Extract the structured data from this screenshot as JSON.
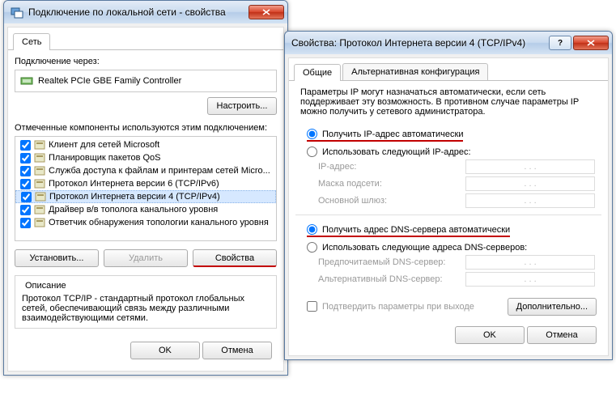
{
  "win1": {
    "title": "Подключение по локальной сети - свойства",
    "tab": "Сеть",
    "connect_via": "Подключение через:",
    "adapter": "Realtek PCIe GBE Family Controller",
    "configure": "Настроить...",
    "components_label": "Отмеченные компоненты используются этим подключением:",
    "items": [
      {
        "label": "Клиент для сетей Microsoft",
        "checked": true
      },
      {
        "label": "Планировщик пакетов QoS",
        "checked": true
      },
      {
        "label": "Служба доступа к файлам и принтерам сетей Micro...",
        "checked": true
      },
      {
        "label": "Протокол Интернета версии 6 (TCP/IPv6)",
        "checked": true
      },
      {
        "label": "Протокол Интернета версии 4 (TCP/IPv4)",
        "checked": true,
        "selected": true
      },
      {
        "label": "Драйвер в/в тополога канального уровня",
        "checked": true
      },
      {
        "label": "Ответчик обнаружения топологии канального уровня",
        "checked": true
      }
    ],
    "install": "Установить...",
    "uninstall": "Удалить",
    "properties": "Свойства",
    "desc_title": "Описание",
    "desc_body": "Протокол TCP/IP - стандартный протокол глобальных сетей, обеспечивающий связь между различными взаимодействующими сетями.",
    "ok": "OK",
    "cancel": "Отмена"
  },
  "win2": {
    "title": "Свойства: Протокол Интернета версии 4 (TCP/IPv4)",
    "tab1": "Общие",
    "tab2": "Альтернативная конфигурация",
    "info": "Параметры IP могут назначаться автоматически, если сеть поддерживает эту возможность. В противном случае параметры IP можно получить у сетевого администратора.",
    "ip_auto": "Получить IP-адрес автоматически",
    "ip_manual": "Использовать следующий IP-адрес:",
    "ip_label": "IP-адрес:",
    "mask_label": "Маска подсети:",
    "gw_label": "Основной шлюз:",
    "dns_auto": "Получить адрес DNS-сервера автоматически",
    "dns_manual": "Использовать следующие адреса DNS-серверов:",
    "dns1_label": "Предпочитаемый DNS-сервер:",
    "dns2_label": "Альтернативный DNS-сервер:",
    "validate": "Подтвердить параметры при выходе",
    "advanced": "Дополнительно...",
    "ok": "OK",
    "cancel": "Отмена",
    "dots": ".   .   ."
  }
}
